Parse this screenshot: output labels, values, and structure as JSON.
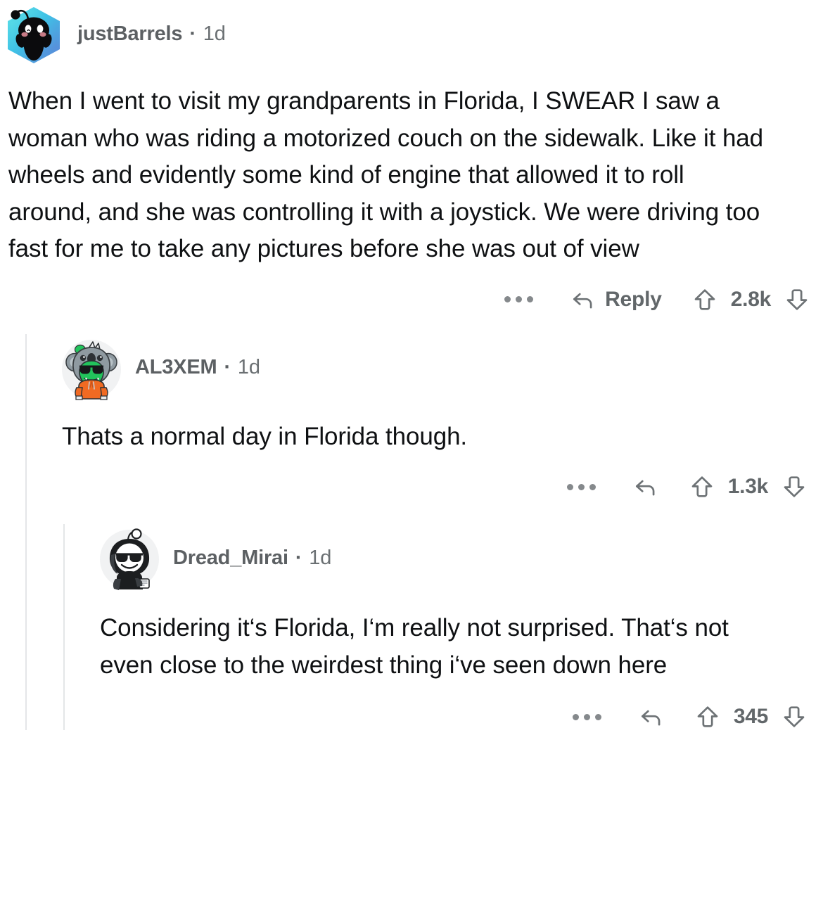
{
  "app": "reddit-comment-thread",
  "comments": [
    {
      "id": "c0",
      "depth": 0,
      "username": "justBarrels",
      "separator": "·",
      "age": "1d",
      "avatar": "snoo-black-cyan-hexagon-avatar",
      "body": "When I went to visit my grandparents in Florida, I SWEAR I saw a woman who was riding a motorized couch on the sidewalk. Like it had wheels and evidently some kind of engine that allowed it to roll around, and she was controlling it with a joystick. We were driving too fast for me to take any pictures before she was out of view",
      "actions": {
        "overflow_label": "…",
        "reply_label": "Reply",
        "show_reply_label": true,
        "upvote_label": "upvote",
        "downvote_label": "downvote",
        "score": "2.8k"
      }
    },
    {
      "id": "c1",
      "depth": 1,
      "username": "AL3XEM",
      "separator": "·",
      "age": "1d",
      "avatar": "koala-hoodie-green-creature-avatar",
      "body": "Thats a normal day in Florida though.",
      "actions": {
        "overflow_label": "…",
        "reply_label": "",
        "show_reply_label": false,
        "upvote_label": "upvote",
        "downvote_label": "downvote",
        "score": "1.3k"
      }
    },
    {
      "id": "c2",
      "depth": 2,
      "username": "Dread_Mirai",
      "separator": "·",
      "age": "1d",
      "avatar": "snoo-black-hoodie-sunglasses-avatar",
      "body": "Considering it‘s Florida, I‘m really not surprised. That‘s not even close to the weirdest thing i‘ve seen down here",
      "actions": {
        "overflow_label": "…",
        "reply_label": "",
        "show_reply_label": false,
        "upvote_label": "upvote",
        "downvote_label": "downvote",
        "score": "345"
      }
    }
  ],
  "colors": {
    "text_primary": "#0f1113",
    "text_meta": "#5c6063",
    "action_gray": "#6d7275",
    "thread_line": "#e4e6e8",
    "background": "#ffffff",
    "avatar_cyan": "#4fd1e0",
    "avatar_blue": "#4a7fd4",
    "avatar_orange": "#f06a22",
    "avatar_green": "#21c45c",
    "avatar_gray": "#9aa5ab"
  }
}
